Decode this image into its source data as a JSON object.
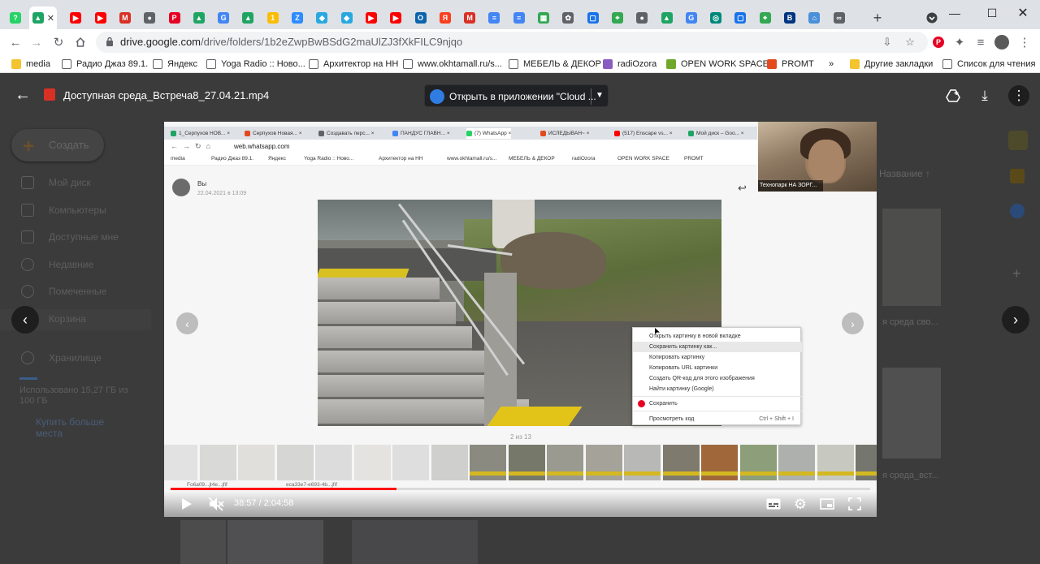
{
  "browser": {
    "tabs": [
      {
        "icon": "whatsapp-icon",
        "color": "#25d366",
        "glyph": "?"
      },
      {
        "icon": "google-drive-icon",
        "color": "#1fa463",
        "glyph": "▲"
      },
      {
        "icon": "youtube-icon",
        "color": "#ff0000",
        "glyph": "▶"
      },
      {
        "icon": "youtube-icon",
        "color": "#ff0000",
        "glyph": "▶"
      },
      {
        "icon": "gmail-icon",
        "color": "#d93025",
        "glyph": "M"
      },
      {
        "icon": "globe-icon",
        "color": "#5f6368",
        "glyph": "●"
      },
      {
        "icon": "pinterest-icon",
        "color": "#e60023",
        "glyph": "P"
      },
      {
        "icon": "google-drive-icon",
        "color": "#1fa463",
        "glyph": "▲"
      },
      {
        "icon": "google-icon",
        "color": "#4285f4",
        "glyph": "G"
      },
      {
        "icon": "google-drive-icon",
        "color": "#1fa463",
        "glyph": "▲"
      },
      {
        "icon": "google-sheets-icon",
        "color": "#fbbc04",
        "glyph": "1"
      },
      {
        "icon": "zoom-icon",
        "color": "#2d8cff",
        "glyph": "Z"
      },
      {
        "icon": "diamond-icon",
        "color": "#28a8e0",
        "glyph": "◆"
      },
      {
        "icon": "diamond-icon",
        "color": "#28a8e0",
        "glyph": "◆"
      },
      {
        "icon": "youtube-icon",
        "color": "#ff0000",
        "glyph": "▶"
      },
      {
        "icon": "youtube-icon",
        "color": "#ff0000",
        "glyph": "▶"
      },
      {
        "icon": "outlook-icon",
        "color": "#0a64ad",
        "glyph": "O"
      },
      {
        "icon": "yandex-icon",
        "color": "#fc3f1d",
        "glyph": "Я"
      },
      {
        "icon": "gmail-icon",
        "color": "#d93025",
        "glyph": "M"
      },
      {
        "icon": "docs-icon",
        "color": "#4285f4",
        "glyph": "≡"
      },
      {
        "icon": "docs-icon",
        "color": "#4285f4",
        "glyph": "≡"
      },
      {
        "icon": "puzzle-icon",
        "color": "#34a853",
        "glyph": "▦"
      },
      {
        "icon": "paw-icon",
        "color": "#5f6368",
        "glyph": "✿"
      },
      {
        "icon": "chat-icon",
        "color": "#1a73e8",
        "glyph": "▢"
      },
      {
        "icon": "maps-icon",
        "color": "#34a853",
        "glyph": "⌖"
      },
      {
        "icon": "globe-icon",
        "color": "#5f6368",
        "glyph": "●"
      },
      {
        "icon": "google-drive-icon",
        "color": "#1fa463",
        "glyph": "▲"
      },
      {
        "icon": "google-icon",
        "color": "#4285f4",
        "glyph": "G"
      },
      {
        "icon": "meet-icon",
        "color": "#00897b",
        "glyph": "◎"
      },
      {
        "icon": "chat-icon",
        "color": "#1a73e8",
        "glyph": "▢"
      },
      {
        "icon": "maps-icon",
        "color": "#34a853",
        "glyph": "⌖"
      },
      {
        "icon": "booking-icon",
        "color": "#003580",
        "glyph": "B"
      },
      {
        "icon": "house-icon",
        "color": "#4a90d9",
        "glyph": "⌂"
      },
      {
        "icon": "link-icon",
        "color": "#5f6368",
        "glyph": "∞"
      }
    ],
    "url_host": "drive.google.com",
    "url_path": "/drive/folders/1b2eZwpBwBSdG2maUlZJ3fXkFILC9njqo",
    "bookmarks": [
      {
        "icon": "folder-icon",
        "label": "media"
      },
      {
        "icon": "globe-icon",
        "label": "Радио Джаз 89.1."
      },
      {
        "icon": "globe-icon",
        "label": "Яндекс"
      },
      {
        "icon": "globe-icon",
        "label": "Yoga Radio :: Ново..."
      },
      {
        "icon": "globe-icon",
        "label": "Архитектор на НН"
      },
      {
        "icon": "globe-icon",
        "label": "www.okhtamall.ru/s..."
      },
      {
        "icon": "globe-icon",
        "label": "МЕБЕЛЬ & ДЕКОР"
      },
      {
        "icon": "ozora-icon",
        "label": "radiOzora"
      },
      {
        "icon": "fl-icon",
        "label": "OPEN WORK SPACE"
      },
      {
        "icon": "promt-icon",
        "label": "PROMT"
      }
    ],
    "bookmarks_more": "»",
    "other_bookmarks": "Другие закладки",
    "reading_list": "Список для чтения"
  },
  "drive_bg": {
    "create": "Создать",
    "nav": [
      "Мой диск",
      "Компьютеры",
      "Доступные мне",
      "Недавние",
      "Помеченные",
      "Корзина",
      "Хранилище"
    ],
    "storage_used": "Использовано 15,27 ГБ из 100 ГБ",
    "buy_more": "Купить больше места",
    "sort_label": "Название",
    "file_1": "я среда сво...",
    "file_2": "я среда_вст..."
  },
  "viewer": {
    "file_name": "Доступная среда_Встреча8_27.04.21.mp4",
    "open_in": "Открыть в приложении \"Cloud ..."
  },
  "video": {
    "time_current": "38:57",
    "time_total": "2:04:58",
    "progress": 0.323,
    "inner": {
      "tabs": [
        "1_Серпухов НОВ...",
        "Серпухов Новая...",
        "Создавать перс...",
        "ПАНДУС ГЛАВН...",
        "(7) WhatsApp",
        "ИСЛЕДЫВАН~",
        "(517) Enscape vs...",
        "Мой диск – Goo..."
      ],
      "url": "web.whatsapp.com",
      "bookmarks": [
        "media",
        "Радио Джаз 89.1.",
        "Яндекс",
        "Yoga Radio :: Ново...",
        "Архитектор на НН",
        "www.okhtamall.ru/s...",
        "МЕБЕЛЬ & ДЕКОР",
        "radiOzora",
        "OPEN WORK SPACE",
        "PROMT"
      ],
      "sender": "Вы",
      "date": "22.04.2021 в 13:09",
      "webcam_name": "Технопарк НА ЗОРГ...",
      "counter": "2 из 13",
      "context_menu": [
        "Открыть картинку в новой вкладке",
        "Сохранить картинку как...",
        "Копировать картинку",
        "Копировать URL картинки",
        "Создать QR-код для этого изображения",
        "Найти картинку (Google)",
        "Сохранить",
        "Просмотреть код"
      ],
      "inspect_shortcut": "Ctrl + Shift + I",
      "download_1": "Fo6a09...jt4e...jfif",
      "download_2": "eca33e7-e693-4b...jfif"
    }
  }
}
